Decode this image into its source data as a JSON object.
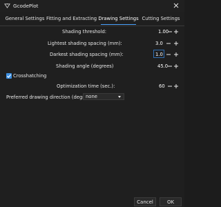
{
  "window": {
    "title": "GcodePlot"
  },
  "tabs": [
    {
      "label": "General Settings"
    },
    {
      "label": "Fitting and Extracting"
    },
    {
      "label": "Drawing Settings"
    },
    {
      "label": "Cutting Settings"
    }
  ],
  "active_tab": "Drawing Settings",
  "settings": {
    "shading_threshold": {
      "label": "Shading threshold:",
      "value": "1.00"
    },
    "lightest_spacing": {
      "label": "Lightest shading spacing (mm):",
      "value": "3.0"
    },
    "darkest_spacing": {
      "label": "Darkest shading spacing (mm):",
      "value": "1.0"
    },
    "shading_angle": {
      "label": "Shading angle (degrees)",
      "value": "45.0"
    },
    "crosshatching": {
      "label": "Crosshatching",
      "checked": true
    },
    "optimization_time": {
      "label": "Optimization time (sec.):",
      "value": "60"
    },
    "preferred_direction": {
      "label": "Preferred drawing direction (degrees):",
      "selected": "none"
    }
  },
  "footer": {
    "cancel_label": "Cancel",
    "ok_label": "OK"
  },
  "colors": {
    "accent": "#4aa3ff",
    "checkbox": "#3d8fe0",
    "background": "#1f1f1f"
  },
  "icons": {
    "app": "gcodeplot-icon",
    "close": "close-icon",
    "minus": "minus-icon",
    "plus": "plus-icon"
  }
}
